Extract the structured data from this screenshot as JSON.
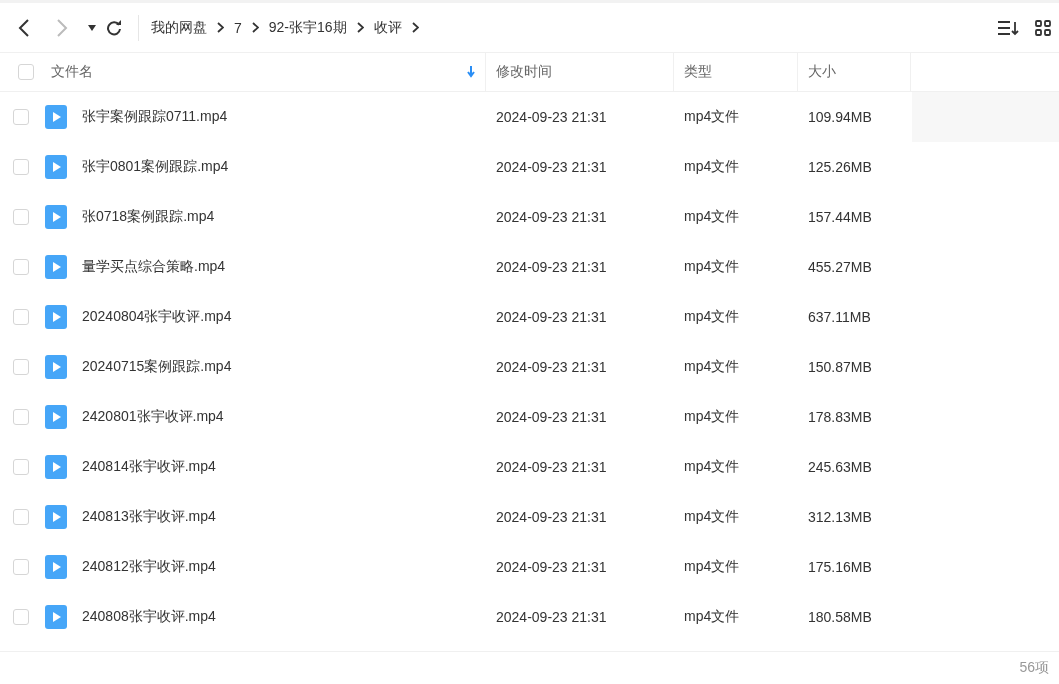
{
  "toolbar": {
    "back_disabled": false,
    "forward_disabled": true,
    "breadcrumb": [
      "我的网盘",
      "7",
      "92-张宇16期",
      "收评"
    ]
  },
  "table": {
    "all_checked": false,
    "columns": [
      {
        "label": "文件名",
        "sorted": true
      },
      {
        "label": "修改时间",
        "sorted": false
      },
      {
        "label": "类型",
        "sorted": false
      },
      {
        "label": "大小",
        "sorted": false
      }
    ],
    "rows": [
      {
        "name": "张宇案例跟踪0711.mp4",
        "modified": "2024-09-23 21:31",
        "type": "mp4文件",
        "size": "109.94MB",
        "checked": false,
        "hovered": true
      },
      {
        "name": "张宇0801案例跟踪.mp4",
        "modified": "2024-09-23 21:31",
        "type": "mp4文件",
        "size": "125.26MB",
        "checked": false,
        "hovered": false
      },
      {
        "name": "张0718案例跟踪.mp4",
        "modified": "2024-09-23 21:31",
        "type": "mp4文件",
        "size": "157.44MB",
        "checked": false,
        "hovered": false
      },
      {
        "name": "量学买点综合策略.mp4",
        "modified": "2024-09-23 21:31",
        "type": "mp4文件",
        "size": "455.27MB",
        "checked": false,
        "hovered": false
      },
      {
        "name": "20240804张宇收评.mp4",
        "modified": "2024-09-23 21:31",
        "type": "mp4文件",
        "size": "637.11MB",
        "checked": false,
        "hovered": false
      },
      {
        "name": "20240715案例跟踪.mp4",
        "modified": "2024-09-23 21:31",
        "type": "mp4文件",
        "size": "150.87MB",
        "checked": false,
        "hovered": false
      },
      {
        "name": "2420801张宇收评.mp4",
        "modified": "2024-09-23 21:31",
        "type": "mp4文件",
        "size": "178.83MB",
        "checked": false,
        "hovered": false
      },
      {
        "name": "240814张宇收评.mp4",
        "modified": "2024-09-23 21:31",
        "type": "mp4文件",
        "size": "245.63MB",
        "checked": false,
        "hovered": false
      },
      {
        "name": "240813张宇收评.mp4",
        "modified": "2024-09-23 21:31",
        "type": "mp4文件",
        "size": "312.13MB",
        "checked": false,
        "hovered": false
      },
      {
        "name": "240812张宇收评.mp4",
        "modified": "2024-09-23 21:31",
        "type": "mp4文件",
        "size": "175.16MB",
        "checked": false,
        "hovered": false
      },
      {
        "name": "240808张宇收评.mp4",
        "modified": "2024-09-23 21:31",
        "type": "mp4文件",
        "size": "180.58MB",
        "checked": false,
        "hovered": false
      }
    ]
  },
  "status_bar": {
    "count": "56项"
  }
}
